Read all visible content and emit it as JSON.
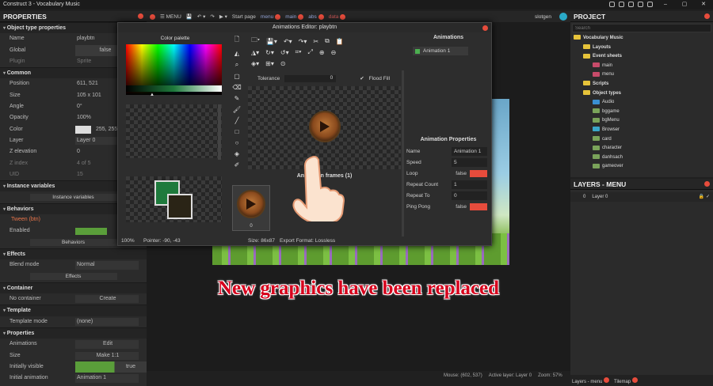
{
  "window": {
    "title": "Construct 3 - Vocabulary Music",
    "user": "slotgen"
  },
  "toolbar": {
    "menu": "MENU",
    "tabs": [
      "Start page",
      "menu",
      "main",
      "abs",
      "data"
    ]
  },
  "properties": {
    "title": "PROPERTIES",
    "sections": [
      {
        "type": "sect",
        "label": "Object type properties"
      },
      {
        "type": "row",
        "k": "Name",
        "v": "playbtn"
      },
      {
        "type": "row",
        "k": "Global",
        "v": "false"
      },
      {
        "type": "row",
        "k": "Plugin",
        "v": "Sprite"
      },
      {
        "type": "sect",
        "label": "Common"
      },
      {
        "type": "row",
        "k": "Position",
        "v": "611, 521"
      },
      {
        "type": "row",
        "k": "Size",
        "v": "105 x 101"
      },
      {
        "type": "row",
        "k": "Angle",
        "v": "0°"
      },
      {
        "type": "row",
        "k": "Opacity",
        "v": "100%"
      },
      {
        "type": "row",
        "k": "Color",
        "v": "255, 255, 2"
      },
      {
        "type": "row",
        "k": "Layer",
        "v": "Layer 0"
      },
      {
        "type": "row",
        "k": "Z elevation",
        "v": "0"
      },
      {
        "type": "row",
        "k": "Z index",
        "v": "4 of 5"
      },
      {
        "type": "row",
        "k": "UID",
        "v": "15"
      },
      {
        "type": "sect",
        "label": "Instance variables"
      },
      {
        "type": "btn",
        "label": "Instance variables"
      },
      {
        "type": "sect",
        "label": "Behaviors"
      },
      {
        "type": "tween",
        "label": "Tween (btn)"
      },
      {
        "type": "row",
        "k": "Enabled",
        "v": ""
      },
      {
        "type": "btn",
        "label": "Behaviors"
      },
      {
        "type": "sect",
        "label": "Effects"
      },
      {
        "type": "row",
        "k": "Blend mode",
        "v": "Normal"
      },
      {
        "type": "btn",
        "label": "Effects"
      },
      {
        "type": "sect",
        "label": "Container"
      },
      {
        "type": "row",
        "k": "No container",
        "v": "Create"
      },
      {
        "type": "sect",
        "label": "Template"
      },
      {
        "type": "row",
        "k": "Template mode",
        "v": "(none)"
      },
      {
        "type": "sect",
        "label": "Properties"
      },
      {
        "type": "row",
        "k": "Animations",
        "v": "Edit"
      },
      {
        "type": "row",
        "k": "Size",
        "v": "Make 1:1"
      },
      {
        "type": "row",
        "k": "Initially visible",
        "v": "true"
      },
      {
        "type": "row",
        "k": "Initial animation",
        "v": "Animation 1"
      }
    ]
  },
  "editor": {
    "title": "Animations Editor: playbtn",
    "palette_title": "Color palette",
    "tolerance_label": "Tolerance",
    "tolerance_value": "0",
    "flood_fill": "Flood Fill",
    "frames_title": "Animation frames (1)",
    "frame_index": "0",
    "zoom": "100%",
    "pointer": "Pointer: -90, -43",
    "size": "Size: 86x87",
    "export": "Export Format: Lossless",
    "animations_title": "Animations",
    "animation_item": "Animation 1",
    "anim_props_title": "Animation Properties",
    "anim_props": [
      {
        "k": "Name",
        "v": "Animation 1"
      },
      {
        "k": "Speed",
        "v": "5"
      },
      {
        "k": "Loop",
        "v": "false"
      },
      {
        "k": "Repeat Count",
        "v": "1"
      },
      {
        "k": "Repeat To",
        "v": "0"
      },
      {
        "k": "Ping Pong",
        "v": "false"
      }
    ],
    "fg_color": "#1e7a3c",
    "bg_color": "#2a2416"
  },
  "caption": "New graphics have been replaced",
  "status": {
    "mouse": "Mouse: (602, 537)",
    "layer": "Active layer: Layer 0",
    "zoom": "Zoom: 57%"
  },
  "project": {
    "title": "PROJECT",
    "search_placeholder": "Search",
    "tree": [
      {
        "d": 0,
        "label": "Vocabulary Music",
        "icon": "folder-icon"
      },
      {
        "d": 1,
        "label": "Layouts",
        "icon": "folder-icon"
      },
      {
        "d": 1,
        "label": "Event sheets",
        "icon": "folder-icon"
      },
      {
        "d": 2,
        "label": "main",
        "icon": "sheet-icon"
      },
      {
        "d": 2,
        "label": "menu",
        "icon": "sheet-icon"
      },
      {
        "d": 1,
        "label": "Scripts",
        "icon": "folder-icon"
      },
      {
        "d": 1,
        "label": "Object types",
        "icon": "folder-icon"
      },
      {
        "d": 2,
        "label": "Audio",
        "icon": "audio-icon"
      },
      {
        "d": 2,
        "label": "bggame",
        "icon": "image-icon"
      },
      {
        "d": 2,
        "label": "bgMenu",
        "icon": "image-icon"
      },
      {
        "d": 2,
        "label": "Browser",
        "icon": "globe-icon"
      },
      {
        "d": 2,
        "label": "card",
        "icon": "image-icon"
      },
      {
        "d": 2,
        "label": "character",
        "icon": "image-icon"
      },
      {
        "d": 2,
        "label": "danhsach",
        "icon": "image-icon"
      },
      {
        "d": 2,
        "label": "gameover",
        "icon": "image-icon"
      }
    ]
  },
  "layers": {
    "title": "LAYERS - MENU",
    "row_index": "0",
    "row_label": "Layer 0"
  },
  "bottom_tabs": [
    "Layers - menu",
    "Tilemap"
  ]
}
